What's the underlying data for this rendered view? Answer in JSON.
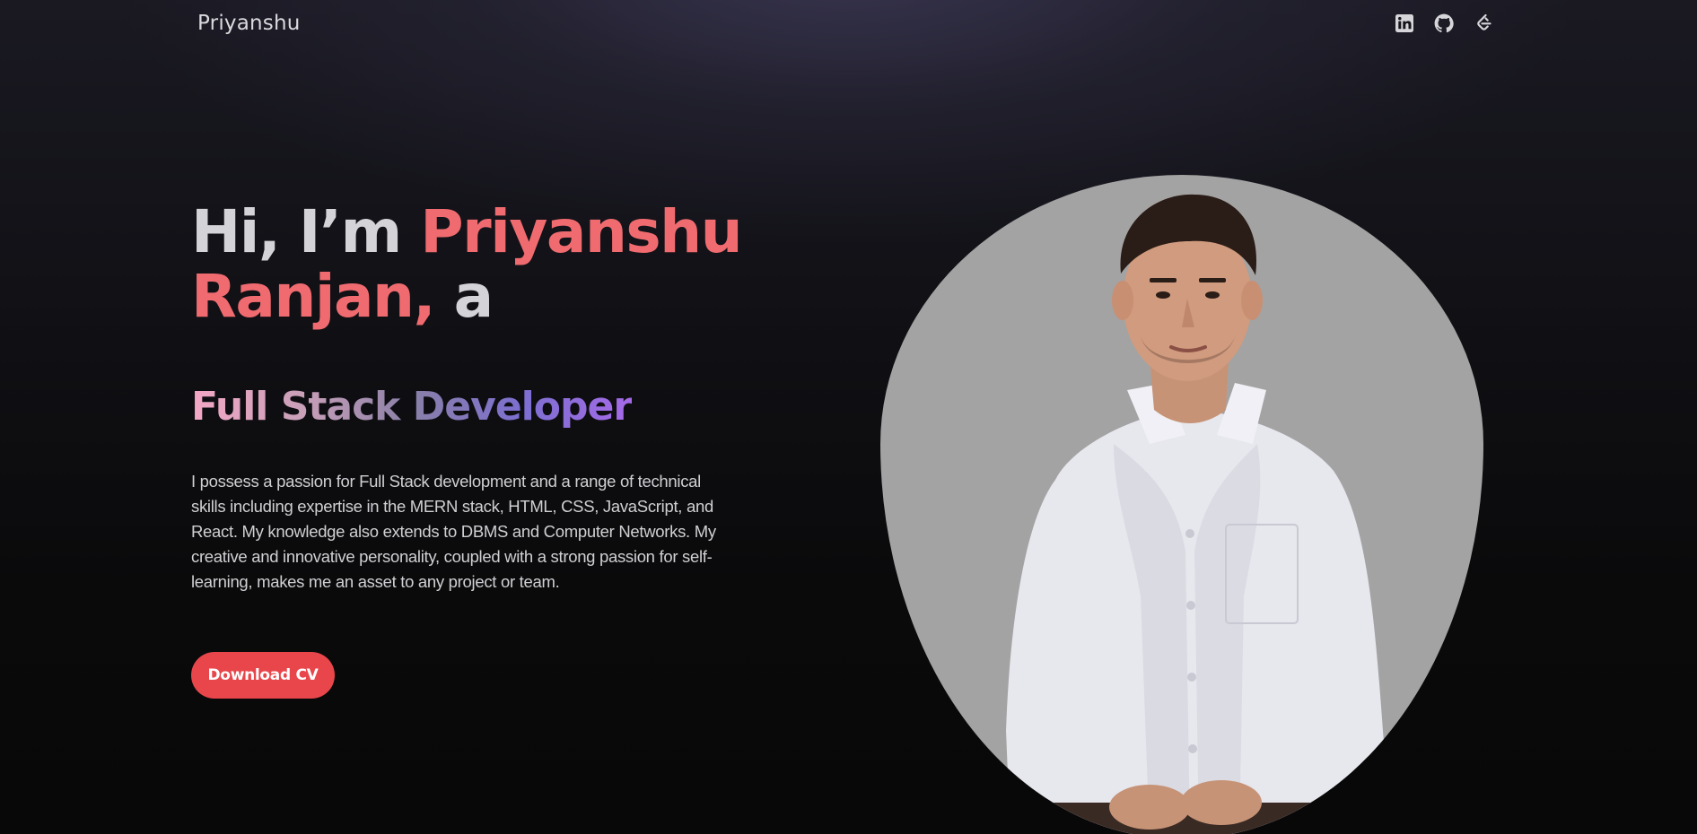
{
  "nav": {
    "brand": "Priyanshu",
    "socials": [
      {
        "icon": "linkedin-icon"
      },
      {
        "icon": "github-icon"
      },
      {
        "icon": "leetcode-icon"
      }
    ]
  },
  "hero": {
    "greeting": "Hi, I’m",
    "name": "Priyanshu Ranjan,",
    "suffix": "a",
    "role_words": [
      "Full",
      "Stack",
      "Developer"
    ],
    "about": "I possess a passion for Full Stack development and a range of technical skills including expertise in the MERN stack, HTML, CSS, JavaScript, and React. My knowledge also extends to DBMS and Computer Networks. My creative and innovative personality, coupled with a strong passion for self-learning, makes me an asset to any project or team.",
    "cta_label": "Download CV"
  },
  "colors": {
    "accent": "#e8464b",
    "name": "#ef6b6f",
    "portrait_bg": "#a3a3a3"
  }
}
